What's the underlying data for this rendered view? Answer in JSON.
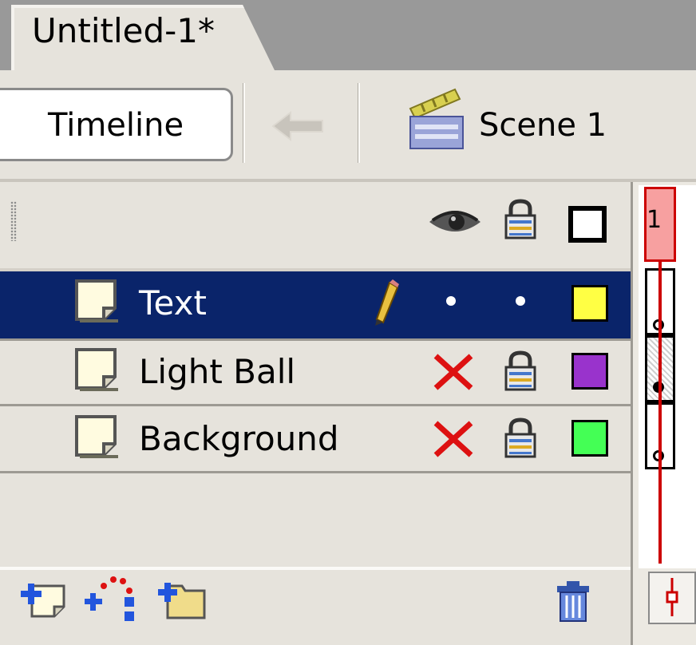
{
  "document": {
    "tab_title": "Untitled-1*"
  },
  "editbar": {
    "timeline_label": "Timeline",
    "scene_label": "Scene 1"
  },
  "layers_header": {
    "columns": [
      "eye-icon",
      "lock-icon",
      "outline-icon"
    ]
  },
  "layers": [
    {
      "name": "Text",
      "selected": true,
      "editing": true,
      "visible": "dot",
      "locked": "dot",
      "color": "#ffff44"
    },
    {
      "name": "Light Ball",
      "selected": false,
      "visible": "hidden",
      "locked": "locked",
      "color": "#9933cc"
    },
    {
      "name": "Background",
      "selected": false,
      "visible": "hidden",
      "locked": "locked",
      "color": "#44ff55"
    }
  ],
  "timeline": {
    "current_frame": "1"
  },
  "colors": {
    "selection": "#0a246a",
    "playhead": "#cc0000",
    "panel": "#e6e3dc"
  }
}
